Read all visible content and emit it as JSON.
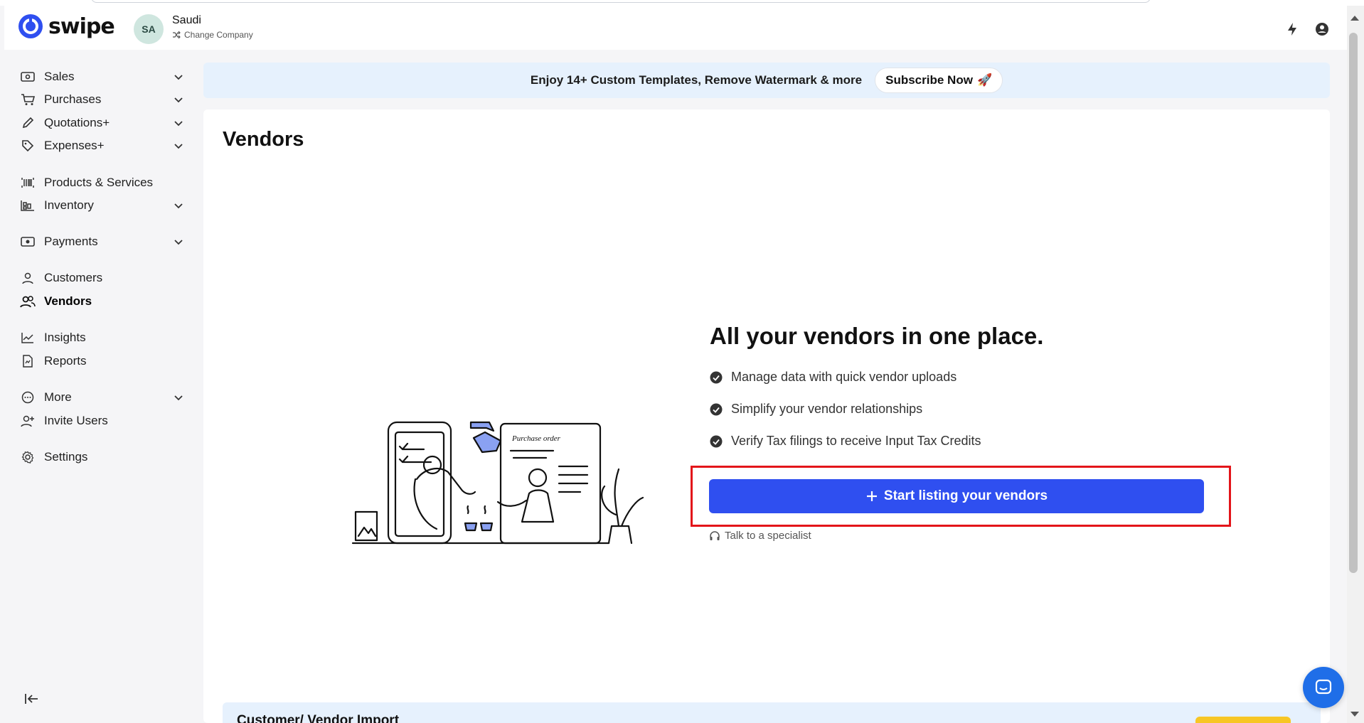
{
  "app": {
    "brand": "swipe",
    "company_initials": "SA",
    "company_name": "Saudi",
    "change_company": "Change Company"
  },
  "sidebar": {
    "items": [
      {
        "label": "Sales",
        "icon": "sales-icon",
        "has_chevron": true
      },
      {
        "label": "Purchases",
        "icon": "cart-icon",
        "has_chevron": true
      },
      {
        "label": "Quotations+",
        "icon": "pencil-icon",
        "has_chevron": true
      },
      {
        "label": "Expenses+",
        "icon": "tag-icon",
        "has_chevron": true
      },
      {
        "label": "Products & Services",
        "icon": "barcode-icon",
        "has_chevron": false
      },
      {
        "label": "Inventory",
        "icon": "inventory-icon",
        "has_chevron": true
      },
      {
        "label": "Payments",
        "icon": "payment-icon",
        "has_chevron": true
      },
      {
        "label": "Customers",
        "icon": "user-icon",
        "has_chevron": false
      },
      {
        "label": "Vendors",
        "icon": "users-icon",
        "has_chevron": false,
        "active": true
      },
      {
        "label": "Insights",
        "icon": "chart-icon",
        "has_chevron": false
      },
      {
        "label": "Reports",
        "icon": "report-icon",
        "has_chevron": false
      },
      {
        "label": "More",
        "icon": "more-icon",
        "has_chevron": true
      },
      {
        "label": "Invite Users",
        "icon": "invite-icon",
        "has_chevron": false
      },
      {
        "label": "Settings",
        "icon": "gear-icon",
        "has_chevron": false
      }
    ]
  },
  "promo": {
    "text": "Enjoy 14+ Custom Templates, Remove Watermark & more",
    "button": "Subscribe Now",
    "button_emoji": "🚀"
  },
  "main": {
    "title": "Vendors",
    "hero_title": "All your vendors in one place.",
    "features": [
      "Manage data with quick vendor uploads",
      "Simplify your vendor relationships",
      "Verify Tax filings to receive Input Tax Credits"
    ],
    "cta": "Start listing your vendors",
    "specialist": "Talk to a specialist",
    "illustration_label": "Purchase order"
  },
  "import_banner": {
    "title": "Customer/ Vendor Import"
  },
  "colors": {
    "primary": "#2f4ff0",
    "highlight": "#e3151a",
    "promo_bg": "#e6f1fd",
    "chat": "#1f6ee8",
    "import_button": "#f7c624"
  }
}
